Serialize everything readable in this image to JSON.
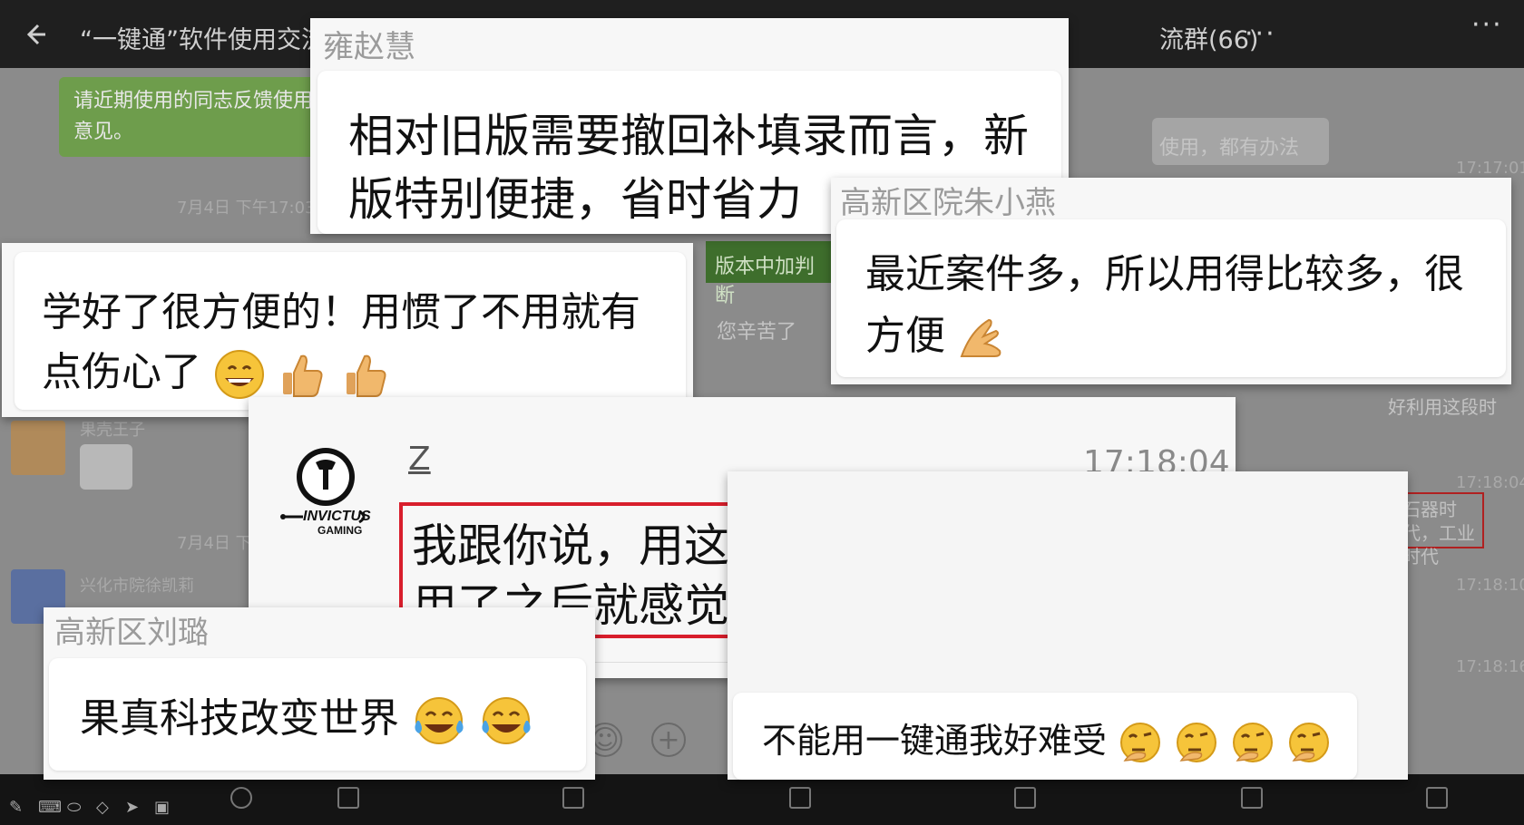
{
  "background": {
    "group_title": "“一键通”软件使用交流",
    "group_title_right": "流群(66)",
    "top_message": "请近期使用的同志反馈使用意见。",
    "date_1": "7月4日 下午17:03",
    "date_2": "7月4日 下",
    "right_message": "使用，都有办法",
    "right_time_1": "17:17:01",
    "version_text": "版本中加判断",
    "thanks_text": "您辛苦了",
    "left_sender": "果壳王子",
    "sender_2": "兴化市院徐凯莉",
    "right_text_2": "好利用这段时",
    "right_time_2": "17:18:04",
    "right_red_text": "石器时代，工业时代",
    "right_time_3": "17:18:10",
    "right_time_4": "17:18:16",
    "colors": {
      "topbar": "#1f1f1f",
      "green": "#6e9d4c",
      "highlight_red": "#d81e2c"
    }
  },
  "cards": {
    "yong": {
      "name": "雍赵慧",
      "line1": "相对旧版需要撤回补填录而言，新",
      "line2": "版特别便捷，省时省力"
    },
    "zhu": {
      "name": "高新区院朱小燕",
      "line1": "最近案件多，所以用得比较多，很",
      "line2": "方便",
      "emoji": "ok-hand-emoji"
    },
    "study": {
      "line1": "学好了很方便的！用惯了不用就有",
      "line2": "点伤心了",
      "emoji": [
        "grinning-emoji",
        "thumbs-up-emoji",
        "thumbs-up-emoji"
      ]
    },
    "z": {
      "sender": "Z",
      "time": "17:18:04",
      "line1": "我跟你说，用这个之前是石器时代，",
      "line2": "用了之后就感觉一脚跨入工业时代",
      "avatar_text": "invictus gaming"
    },
    "liu": {
      "name": "高新区刘璐",
      "text": "果真科技改变世界",
      "emoji": [
        "tears-of-joy-emoji",
        "tears-of-joy-emoji"
      ]
    },
    "bad": {
      "text": "不能用一键通我好难受",
      "emoji": [
        "thinking-emoji",
        "thinking-emoji",
        "thinking-emoji",
        "thinking-emoji"
      ]
    }
  }
}
